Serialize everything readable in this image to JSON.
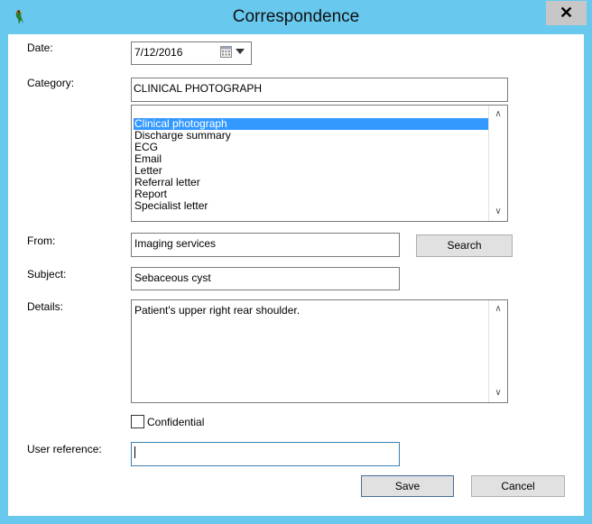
{
  "window": {
    "title": "Correspondence",
    "close_label": "✕"
  },
  "form": {
    "date_label": "Date:",
    "date_value": "7/12/2016",
    "category_label": "Category:",
    "category_value": "CLINICAL PHOTOGRAPH",
    "category_options": [
      "Clinical photograph",
      "Discharge summary",
      "ECG",
      "Email",
      "Letter",
      "Referral letter",
      "Report",
      "Specialist letter"
    ],
    "category_selected": "Clinical photograph",
    "from_label": "From:",
    "from_value": "Imaging services",
    "search_label": "Search",
    "subject_label": "Subject:",
    "subject_value": "Sebaceous cyst",
    "details_label": "Details:",
    "details_value": "Patient's upper right rear shoulder.",
    "confidential_label": "Confidential",
    "confidential_checked": false,
    "user_reference_label": "User reference:",
    "user_reference_value": ""
  },
  "buttons": {
    "save_label": "Save",
    "cancel_label": "Cancel"
  },
  "icons": {
    "app": "bird-icon",
    "date_picker": "calendar-icon",
    "dropdown": "chevron-down-icon"
  },
  "colors": {
    "title_bar": "#68c8ee",
    "selection": "#3399ff"
  }
}
